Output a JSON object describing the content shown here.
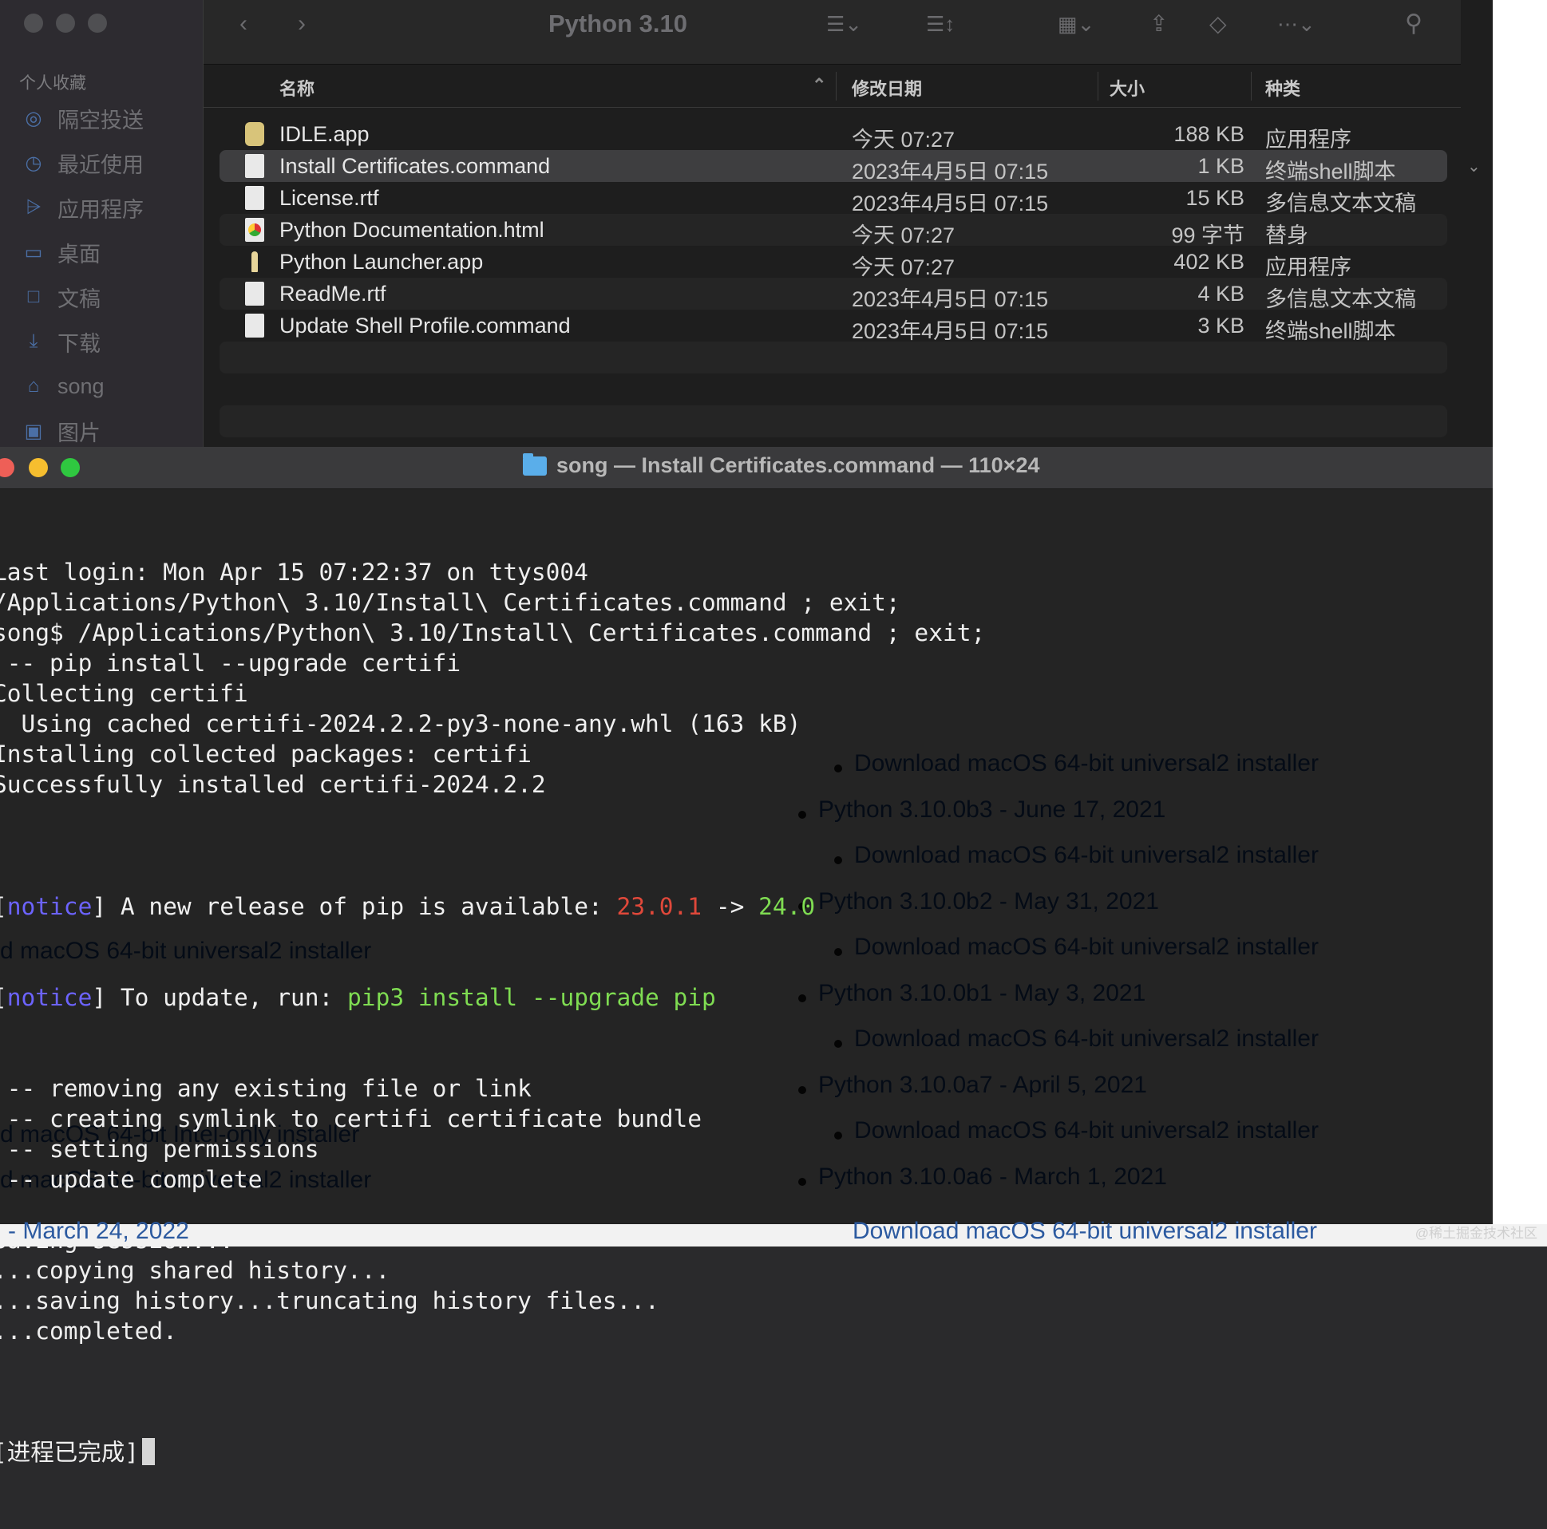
{
  "finder": {
    "title": "Python 3.10",
    "sidebar_heading": "个人收藏",
    "sidebar": [
      {
        "label": "隔空投送",
        "icon": "airdrop-icon"
      },
      {
        "label": "最近使用",
        "icon": "clock-icon"
      },
      {
        "label": "应用程序",
        "icon": "applications-icon"
      },
      {
        "label": "桌面",
        "icon": "desktop-icon"
      },
      {
        "label": "文稿",
        "icon": "document-icon"
      },
      {
        "label": "下载",
        "icon": "download-icon"
      },
      {
        "label": "song",
        "icon": "home-icon"
      },
      {
        "label": "图片",
        "icon": "pictures-icon"
      }
    ],
    "columns": {
      "name": "名称",
      "date": "修改日期",
      "size": "大小",
      "kind": "种类"
    },
    "files": [
      {
        "name": "IDLE.app",
        "date": "今天 07:27",
        "size": "188 KB",
        "kind": "应用程序",
        "icon": "app-icon"
      },
      {
        "name": "Install Certificates.command",
        "date": "2023年4月5日 07:15",
        "size": "1 KB",
        "kind": "终端shell脚本",
        "icon": "shell-script-icon"
      },
      {
        "name": "License.rtf",
        "date": "2023年4月5日 07:15",
        "size": "15 KB",
        "kind": "多信息文本文稿",
        "icon": "rtf-icon"
      },
      {
        "name": "Python Documentation.html",
        "date": "今天 07:27",
        "size": "99 字节",
        "kind": "替身",
        "icon": "html-alias-icon"
      },
      {
        "name": "Python Launcher.app",
        "date": "今天 07:27",
        "size": "402 KB",
        "kind": "应用程序",
        "icon": "rocket-icon"
      },
      {
        "name": "ReadMe.rtf",
        "date": "2023年4月5日 07:15",
        "size": "4 KB",
        "kind": "多信息文本文稿",
        "icon": "rtf-icon"
      },
      {
        "name": "Update Shell Profile.command",
        "date": "2023年4月5日 07:15",
        "size": "3 KB",
        "kind": "终端shell脚本",
        "icon": "shell-script-icon"
      }
    ],
    "selected_index": 1
  },
  "terminal": {
    "title": "song — Install Certificates.command — 110×24",
    "lines": [
      "Last login: Mon Apr 15 07:22:37 on ttys004",
      "/Applications/Python\\ 3.10/Install\\ Certificates.command ; exit;",
      "song$ /Applications/Python\\ 3.10/Install\\ Certificates.command ; exit;",
      " -- pip install --upgrade certifi",
      "Collecting certifi",
      "  Using cached certifi-2024.2.2-py3-none-any.whl (163 kB)",
      "Installing collected packages: certifi",
      "Successfully installed certifi-2024.2.2",
      ""
    ],
    "notice1": {
      "open": "[",
      "tag": "notice",
      "close": "] A new release of pip is available: ",
      "old": "23.0.1",
      "arrow": " -> ",
      "new": "24.0"
    },
    "notice2": {
      "open": "[",
      "tag": "notice",
      "close": "] To update, run: ",
      "cmd": "pip3 install --upgrade pip"
    },
    "lines2": [
      " -- removing any existing file or link",
      " -- creating symlink to certifi certificate bundle",
      " -- setting permissions",
      " -- update complete",
      "",
      "Saving session...",
      "...copying shared history...",
      "...saving history...truncating history files...",
      "...completed.",
      ""
    ],
    "final": "[进程已完成]"
  },
  "background_page": {
    "items": [
      "Download macOS 64-bit universal2 installer",
      "Python 3.10.0b3 - June 17, 2021",
      "Download macOS 64-bit universal2 installer",
      "Python 3.10.0b2 - May 31, 2021",
      "Download macOS 64-bit universal2 installer",
      "Python 3.10.0b1 - May 3, 2021",
      "Download macOS 64-bit universal2 installer",
      "Python 3.10.0a7 - April 5, 2021",
      "Download macOS 64-bit universal2 installer",
      "Python 3.10.0a6 - March 1, 2021",
      "Download macOS 64-bit universal2 installer"
    ],
    "left_fragments": [
      "d macOS 64-bit universal2 installer",
      "d macOS 64-bit Intel-only installer",
      "d macOS 64-bit universal2 installer",
      "- March 24, 2022"
    ],
    "watermark": "@稀土掘金技术社区"
  }
}
